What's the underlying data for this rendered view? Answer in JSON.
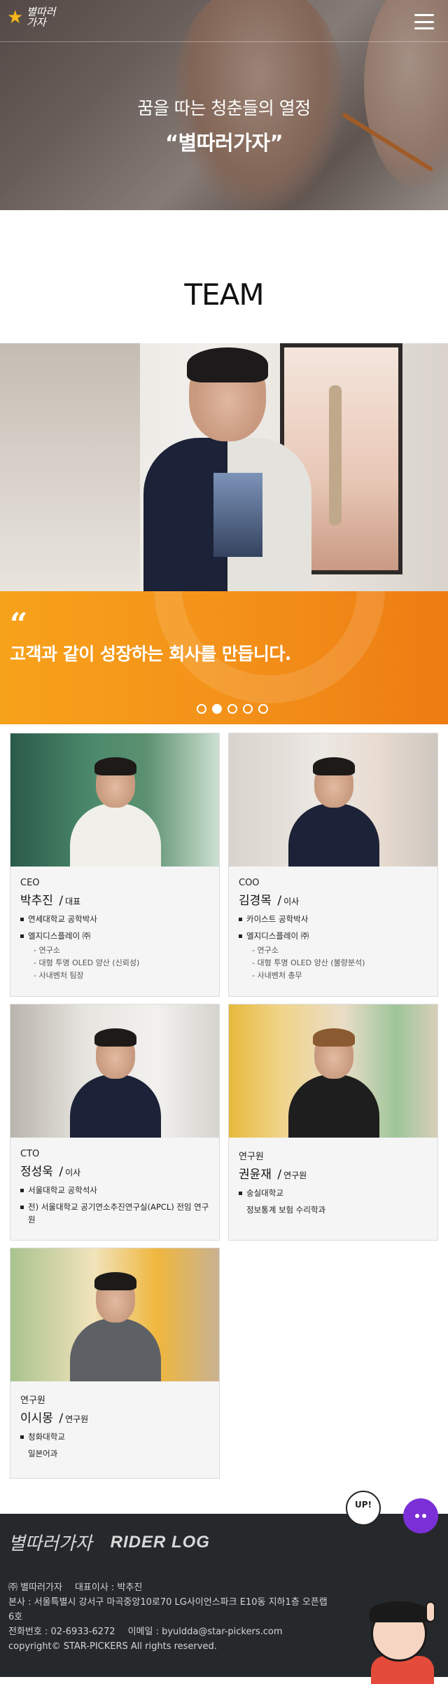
{
  "header": {
    "logo_text": "별따러\n가자",
    "menu_icon": "hamburger-menu-icon"
  },
  "hero": {
    "line1": "꿈을 따는 청춘들의 열정",
    "line2": "“별따러가자”"
  },
  "team_title": "TEAM",
  "slider": {
    "quote_mark": "“",
    "quote": "고객과 같이 성장하는 회사를 만듭니다.",
    "dots": 5,
    "active_dot": 2
  },
  "members": [
    {
      "role": "CEO",
      "name": "박추진",
      "title": "대표",
      "items": [
        {
          "text": "연세대학교 공학박사",
          "subs": []
        },
        {
          "text": "엘지디스플레이 ㈜",
          "subs": [
            "- 연구소",
            "- 대형 투명 OLED 양산 (신뢰성)",
            "- 사내벤처 팀장"
          ]
        }
      ]
    },
    {
      "role": "COO",
      "name": "김경목",
      "title": "이사",
      "items": [
        {
          "text": "카이스트 공학박사",
          "subs": []
        },
        {
          "text": "엘지디스플레이 ㈜",
          "subs": [
            "- 연구소",
            "- 대형 투명 OLED 양산 (불량분석)",
            "- 사내벤처 총무"
          ]
        }
      ]
    },
    {
      "role": "CTO",
      "name": "정성욱",
      "title": "이사",
      "items": [
        {
          "text": "서울대학교 공학석사",
          "subs": []
        },
        {
          "text": "전) 서울대학교 공기연소추진연구실(APCL) 전임 연구원",
          "subs": []
        }
      ]
    },
    {
      "role": "연구원",
      "name": "권윤재",
      "title": "연구원",
      "items": [
        {
          "text": "숭실대학교",
          "subs": []
        },
        {
          "plain": "정보통계 보험 수리학과"
        }
      ]
    },
    {
      "role": "연구원",
      "name": "이시몽",
      "title": "연구원",
      "items": [
        {
          "text": "청화대학교",
          "subs": []
        },
        {
          "plain": "일본어과"
        }
      ]
    }
  ],
  "footer": {
    "logo1": "별따러가자",
    "logo2": "RIDER LOG",
    "company_line": "㈜ 별따러가자",
    "ceo_line": "대표이사 : 박추진",
    "address": "본사 : 서울특별시 강서구 마곡중앙10로70 LG사이언스파크 E10동 지하1층 오픈랩 6호",
    "phone": "전화번호 : 02-6933-6272",
    "email": "이메일 : byuldda@star-pickers.com",
    "copyright": "copyright© STAR-PICKERS All rights reserved.",
    "up_button": "UP!"
  }
}
